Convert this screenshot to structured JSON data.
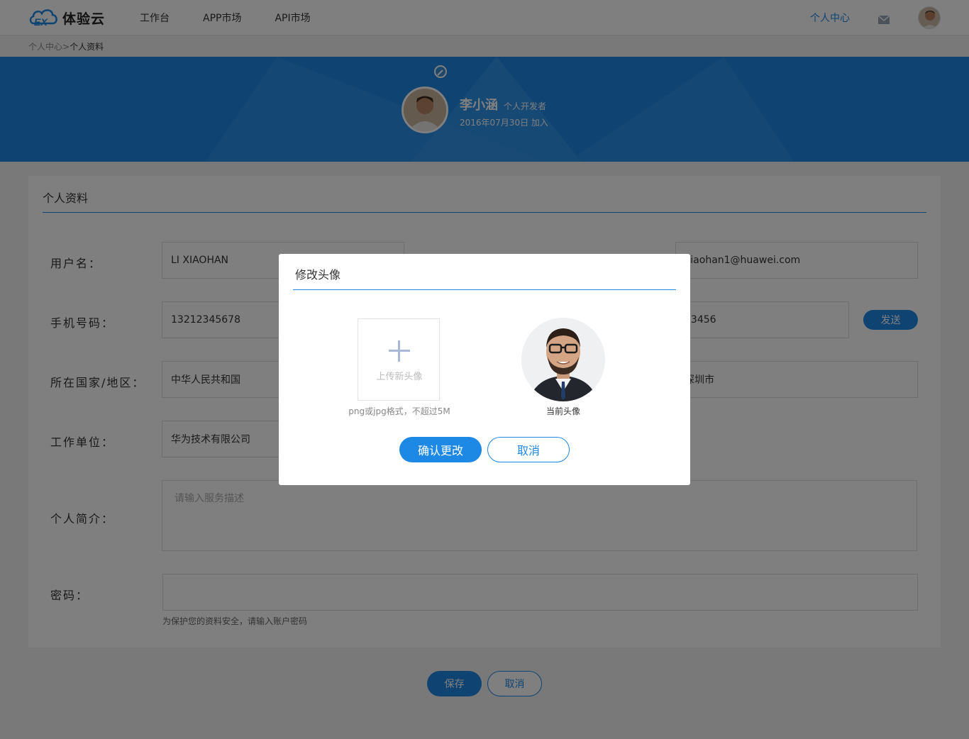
{
  "app": {
    "logo_text": "体验云",
    "nav": [
      "工作台",
      "APP市场",
      "API市场"
    ],
    "personal_center": "个人中心",
    "icons": {
      "mail": "mail-icon",
      "avatar": "avatar"
    }
  },
  "breadcrumb": {
    "parent": "个人中心",
    "separator": ">",
    "current": "个人资料"
  },
  "banner": {
    "name": "李小涵",
    "role": "个人开发者",
    "joined": "2016年07月30日  加入"
  },
  "form": {
    "title": "个人资料",
    "username_label": "用户名：",
    "username_value": "LI XIAOHAN",
    "email_value": "xiaohan1@huawei.com",
    "phone_label": "手机号码：",
    "phone_value": "13212345678",
    "code_value": "23456",
    "send_label": "发送",
    "country_label": "所在国家/地区：",
    "country_value": "中华人民共和国",
    "city_value": "深圳市",
    "company_label": "工作单位：",
    "company_value": "华为技术有限公司",
    "bio_label": "个人简介：",
    "bio_placeholder": "请输入服务描述",
    "password_label": "密码：",
    "password_hint": "为保护您的资料安全，请输入账户密码",
    "save_label": "保存",
    "cancel_label": "取消"
  },
  "modal": {
    "title": "修改头像",
    "upload_label": "上传新头像",
    "upload_hint": "png或jpg格式，不超过5M",
    "current_label": "当前头像",
    "confirm_label": "确认更改",
    "cancel_label": "取消"
  },
  "colors": {
    "primary": "#1e88e5",
    "overlay": "rgba(0,0,0,0.5)"
  }
}
